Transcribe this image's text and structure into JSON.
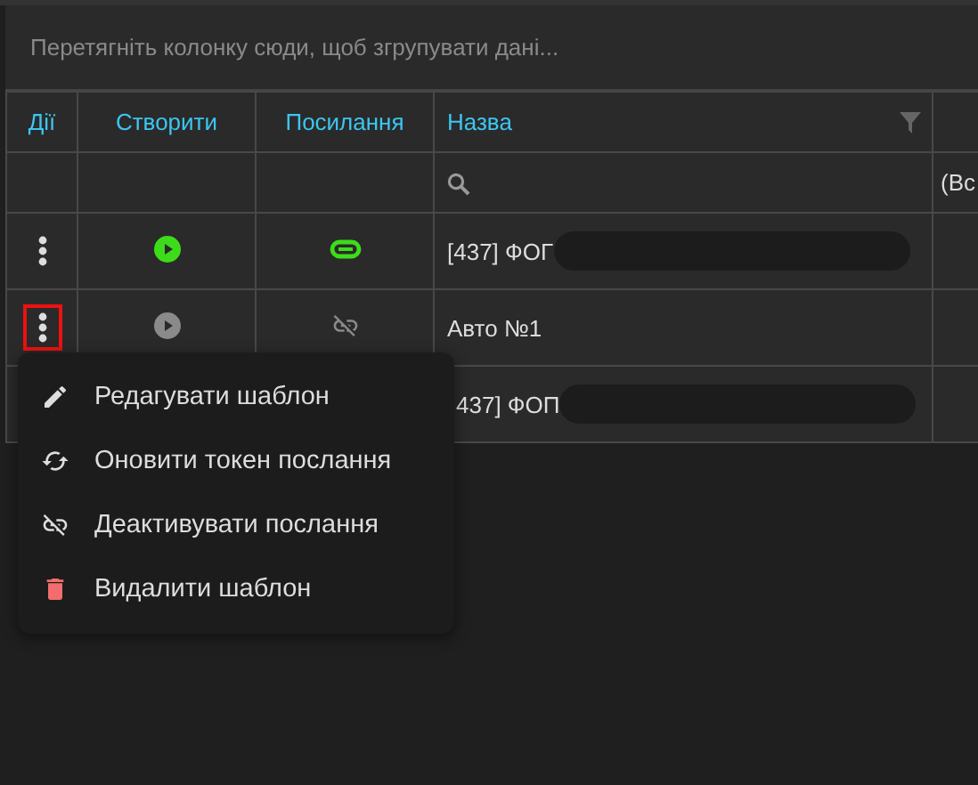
{
  "group_panel": {
    "placeholder": "Перетягніть колонку сюди, щоб згрупувати дані..."
  },
  "table": {
    "columns": [
      {
        "label": "Дії"
      },
      {
        "label": "Створити"
      },
      {
        "label": "Посилання"
      },
      {
        "label": "Назва",
        "filter": true
      }
    ],
    "filter_row": {
      "column_5": "(Вс"
    },
    "rows": [
      {
        "name": "[437] ФОГ",
        "redacted": true,
        "create_active": true,
        "link_active": true,
        "menu_open": false
      },
      {
        "name": "Авто №1",
        "redacted": false,
        "create_active": false,
        "link_active": false,
        "menu_open": true
      },
      {
        "name": "437] ФОП",
        "redacted": true
      }
    ]
  },
  "context_menu": {
    "items": [
      {
        "kind": "edit",
        "label": "Редагувати шаблон"
      },
      {
        "kind": "refresh",
        "label": "Оновити токен послання"
      },
      {
        "kind": "unlink",
        "label": "Деактивувати послання"
      },
      {
        "kind": "delete",
        "label": "Видалити шаблон"
      }
    ]
  }
}
